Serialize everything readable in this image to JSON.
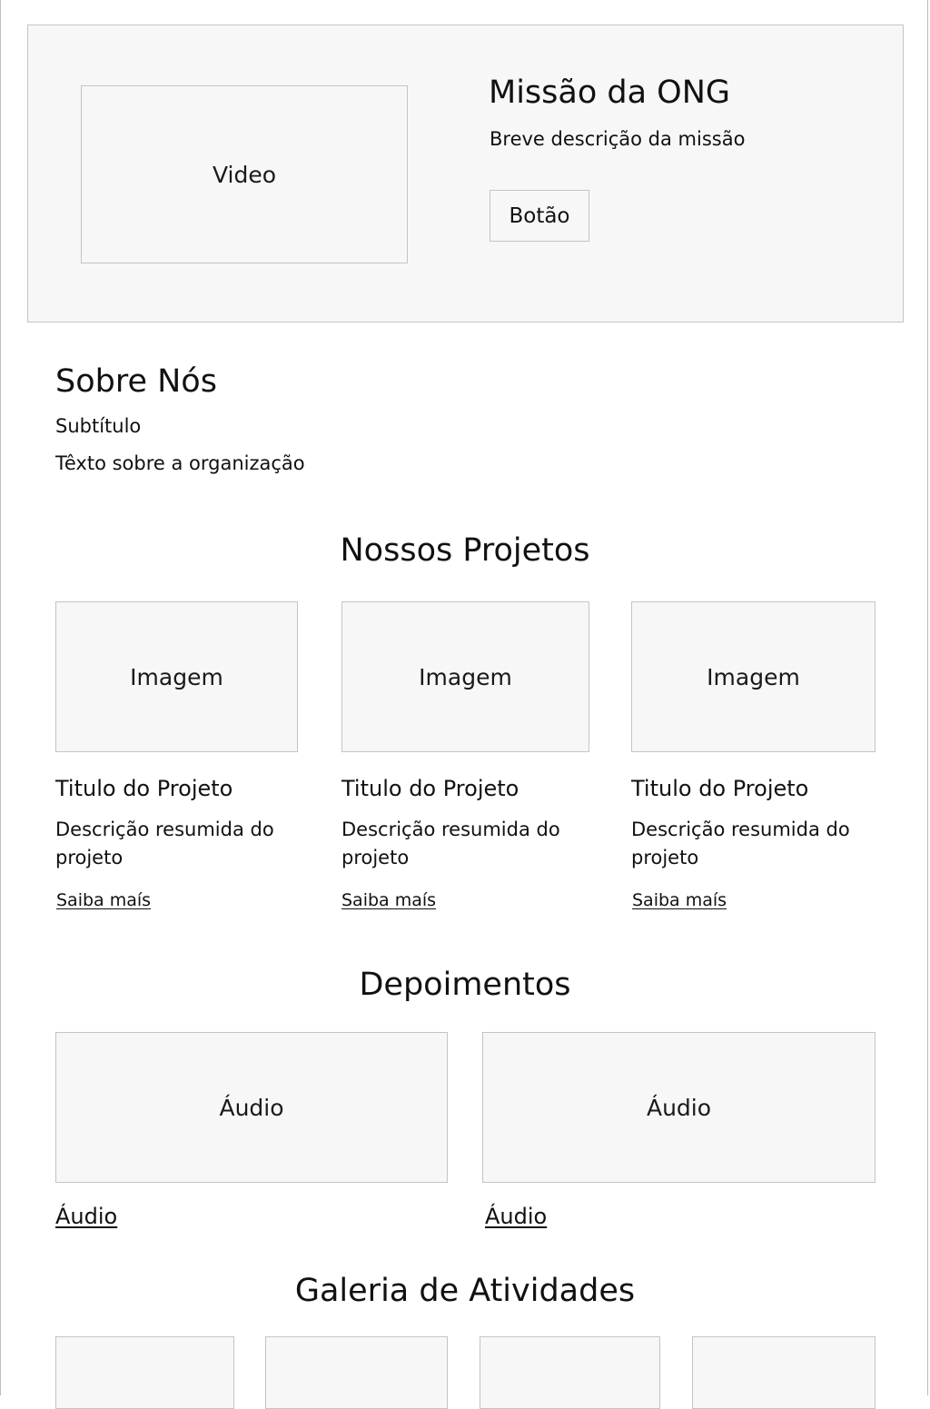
{
  "hero": {
    "video_label": "Video",
    "title": "Missão da ONG",
    "description": "Breve descrição da missão",
    "button_label": "Botão"
  },
  "about": {
    "title": "Sobre Nós",
    "subtitle": "Subtítulo",
    "text": "Têxto sobre a organização"
  },
  "projects": {
    "title": "Nossos Projetos",
    "cards": [
      {
        "image_label": "Imagem",
        "title": "Titulo do Projeto",
        "description": "Descrição resumida do projeto",
        "link": "Saiba maís"
      },
      {
        "image_label": "Imagem",
        "title": "Titulo do Projeto",
        "description": "Descrição resumida do projeto",
        "link": "Saiba maís"
      },
      {
        "image_label": "Imagem",
        "title": "Titulo do Projeto",
        "description": "Descrição resumida do projeto",
        "link": "Saiba maís"
      }
    ]
  },
  "testimonials": {
    "title": "Depoimentos",
    "items": [
      {
        "box_label": "Áudio",
        "link": "Áudio"
      },
      {
        "box_label": "Áudio",
        "link": "Áudio"
      }
    ]
  },
  "gallery": {
    "title": "Galeria de Atividades"
  }
}
